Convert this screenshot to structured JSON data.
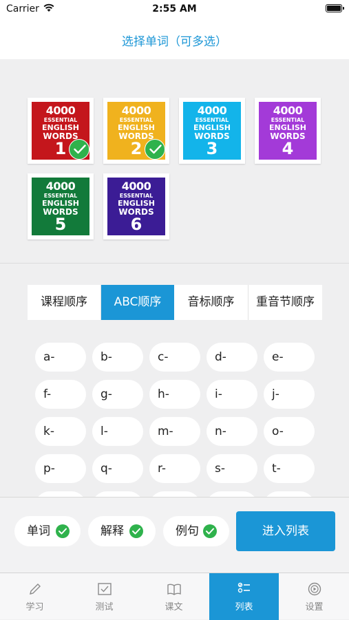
{
  "status_bar": {
    "carrier": "Carrier",
    "time": "2:55 AM"
  },
  "nav": {
    "title": "选择单词（可多选）"
  },
  "books": [
    {
      "lines": [
        "4000",
        "ESSENTIAL",
        "ENGLISH",
        "WORDS",
        "1"
      ],
      "color": "#c4161c",
      "selected": true
    },
    {
      "lines": [
        "4000",
        "ESSENTIAL",
        "ENGLISH",
        "WORDS",
        "2"
      ],
      "color": "#f0b21e",
      "selected": true
    },
    {
      "lines": [
        "4000",
        "ESSENTIAL",
        "ENGLISH",
        "WORDS",
        "3"
      ],
      "color": "#13b4ea",
      "selected": false
    },
    {
      "lines": [
        "4000",
        "ESSENTIAL",
        "ENGLISH",
        "WORDS",
        "4"
      ],
      "color": "#a33ad8",
      "selected": false
    },
    {
      "lines": [
        "4000",
        "ESSENTIAL",
        "ENGLISH",
        "WORDS",
        "5"
      ],
      "color": "#127a3a",
      "selected": false
    },
    {
      "lines": [
        "4000",
        "ESSENTIAL",
        "ENGLISH",
        "WORDS",
        "6"
      ],
      "color": "#3b1c95",
      "selected": false
    }
  ],
  "order_tabs": [
    {
      "label": "课程顺序",
      "active": false
    },
    {
      "label": "ABC顺序",
      "active": true
    },
    {
      "label": "音标顺序",
      "active": false
    },
    {
      "label": "重音节顺序",
      "active": false
    }
  ],
  "letters": [
    "a-",
    "b-",
    "c-",
    "d-",
    "e-",
    "f-",
    "g-",
    "h-",
    "i-",
    "j-",
    "k-",
    "l-",
    "m-",
    "n-",
    "o-",
    "p-",
    "q-",
    "r-",
    "s-",
    "t-",
    "",
    "",
    "",
    "",
    ""
  ],
  "filters": [
    {
      "label": "单词",
      "checked": true
    },
    {
      "label": "解释",
      "checked": true
    },
    {
      "label": "例句",
      "checked": true
    }
  ],
  "enter_button": "进入列表",
  "tabs": [
    {
      "label": "学习",
      "icon": "pencil-icon",
      "active": false
    },
    {
      "label": "测试",
      "icon": "test-check-icon",
      "active": false
    },
    {
      "label": "课文",
      "icon": "book-icon",
      "active": false
    },
    {
      "label": "列表",
      "icon": "list-icon",
      "active": true
    },
    {
      "label": "设置",
      "icon": "settings-play-icon",
      "active": false
    }
  ],
  "colors": {
    "accent": "#1b96d6",
    "check": "#2fb24c",
    "background": "#efeff0"
  }
}
